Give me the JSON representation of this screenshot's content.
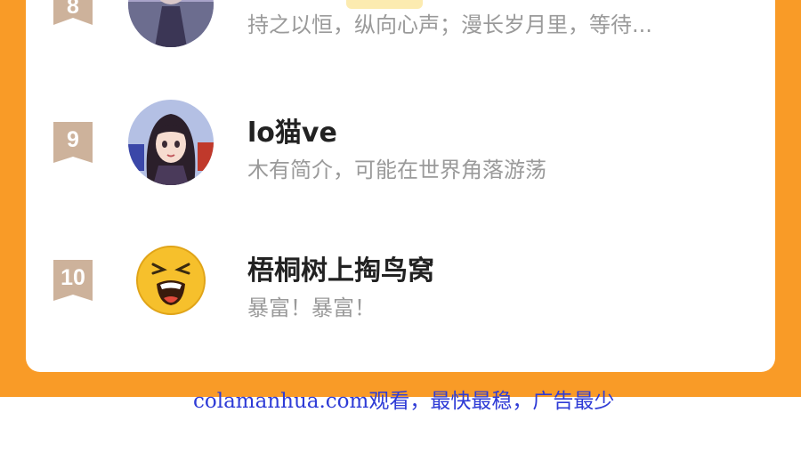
{
  "ranking": {
    "items": [
      {
        "rank": "8",
        "name": "",
        "bio": "持之以恒，纵向心声；漫长岁月里，等待..."
      },
      {
        "rank": "9",
        "name": "lo猫ve",
        "bio": "木有简介，可能在世界角落游荡"
      },
      {
        "rank": "10",
        "name": "梧桐树上掏鸟窝",
        "bio": "暴富！暴富！"
      }
    ]
  },
  "watermark": {
    "text": "colamanhua.com观看，最快最稳，广告最少"
  },
  "colors": {
    "page_background": "#f99b27",
    "card": "#ffffff",
    "rank_badge": "#cdb29b",
    "name_text": "#222222",
    "bio_text": "#9a9a9a",
    "watermark_text": "#2e3bd6"
  }
}
